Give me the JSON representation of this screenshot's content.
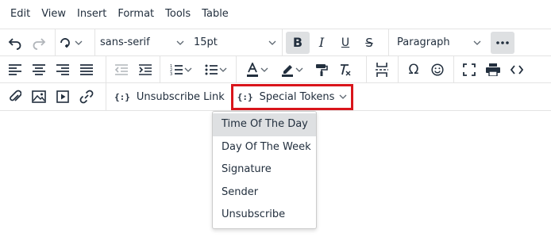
{
  "menubar": {
    "items": [
      "Edit",
      "View",
      "Insert",
      "Format",
      "Tools",
      "Table"
    ]
  },
  "toolbar": {
    "font_family": "sans-serif",
    "font_size": "15pt",
    "block_format": "Paragraph",
    "bold_glyph": "B",
    "italic_glyph": "I",
    "underline_glyph": "U",
    "strike_glyph": "S",
    "omega_glyph": "Ω",
    "unsubscribe_label": "Unsubscribe Link",
    "special_tokens_label": "Special Tokens",
    "token_glyph": "{:}"
  },
  "dropdown": {
    "items": [
      "Time Of The Day",
      "Day Of The Week",
      "Signature",
      "Sender",
      "Unsubscribe"
    ],
    "selected_index": 0
  },
  "colors": {
    "highlight_border": "#d9151b",
    "active_bg": "#dee0e2",
    "text": "#222f3e"
  }
}
